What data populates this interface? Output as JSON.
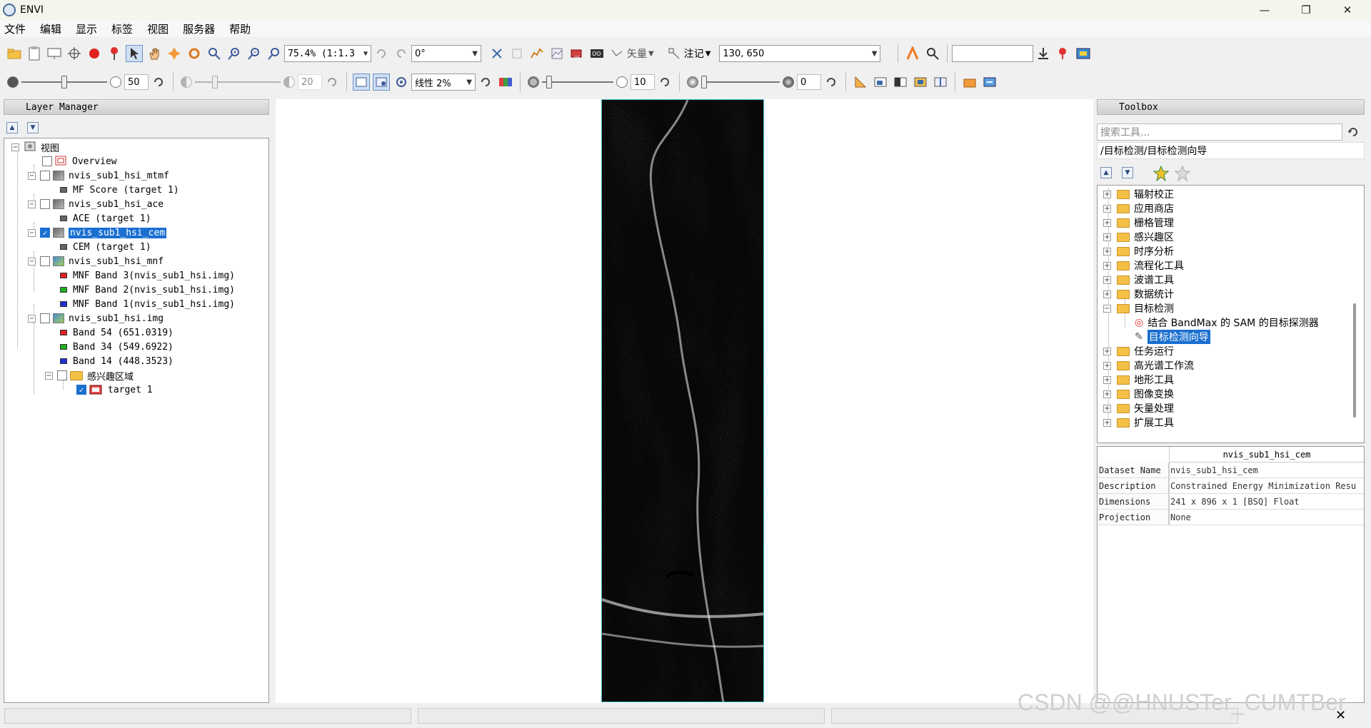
{
  "window": {
    "title": "ENVI"
  },
  "menu": [
    "文件",
    "编辑",
    "显示",
    "标签",
    "视图",
    "服务器",
    "帮助"
  ],
  "toolbar1": {
    "zoom_value": "75.4% (1:1.3",
    "rotation_value": "0°",
    "vector_label": "矢量",
    "annotation_label": "注记",
    "coordinate_value": "130, 650",
    "search_value": ""
  },
  "toolbar2": {
    "brightness_value": "50",
    "contrast_value": "20",
    "stretch_value": "线性 2%",
    "sharpen_value": "10",
    "transparency_value": "0"
  },
  "layer_manager": {
    "title": "Layer Manager",
    "items": [
      {
        "label": "视图"
      },
      {
        "label": "Overview"
      },
      {
        "label": "nvis_sub1_hsi_mtmf"
      },
      {
        "label": "MF Score (target 1)"
      },
      {
        "label": "nvis_sub1_hsi_ace"
      },
      {
        "label": "ACE (target 1)"
      },
      {
        "label": "nvis_sub1_hsi_cem",
        "selected": true,
        "checked": true
      },
      {
        "label": "CEM (target 1)"
      },
      {
        "label": "nvis_sub1_hsi_mnf"
      },
      {
        "label": "MNF Band 3(nvis_sub1_hsi.img)"
      },
      {
        "label": "MNF Band 2(nvis_sub1_hsi.img)"
      },
      {
        "label": "MNF Band 1(nvis_sub1_hsi.img)"
      },
      {
        "label": "nvis_sub1_hsi.img"
      },
      {
        "label": "Band 54 (651.0319)"
      },
      {
        "label": "Band 34 (549.6922)"
      },
      {
        "label": "Band 14 (448.3523)"
      },
      {
        "label": "感兴趣区域"
      },
      {
        "label": "target 1",
        "checked": true
      }
    ]
  },
  "toolbox": {
    "title": "Toolbox",
    "search_placeholder": "搜索工具...",
    "path": "/目标检测/目标检测向导",
    "folders": [
      {
        "label": "辐射校正"
      },
      {
        "label": "应用商店"
      },
      {
        "label": "栅格管理"
      },
      {
        "label": "感兴趣区"
      },
      {
        "label": "时序分析"
      },
      {
        "label": "流程化工具"
      },
      {
        "label": "波谱工具"
      },
      {
        "label": "数据统计"
      },
      {
        "label": "目标检测",
        "expanded": true
      },
      {
        "label": "结合 BandMax 的 SAM 的目标探测器",
        "child": true
      },
      {
        "label": "目标检测向导",
        "child": true,
        "selected": true
      },
      {
        "label": "任务运行"
      },
      {
        "label": "高光谱工作流"
      },
      {
        "label": "地形工具"
      },
      {
        "label": "图像变换"
      },
      {
        "label": "矢量处理"
      },
      {
        "label": "扩展工具"
      }
    ]
  },
  "properties": {
    "header": "nvis_sub1_hsi_cem",
    "rows": [
      {
        "key": "Dataset Name",
        "value": "nvis_sub1_hsi_cem"
      },
      {
        "key": "Description",
        "value": "Constrained Energy Minimization Resu"
      },
      {
        "key": "Dimensions",
        "value": "241 x 896 x 1 [BSQ] Float"
      },
      {
        "key": "Projection",
        "value": "None"
      }
    ]
  },
  "watermark": "CSDN @@HNUSTer_CUMTBer"
}
